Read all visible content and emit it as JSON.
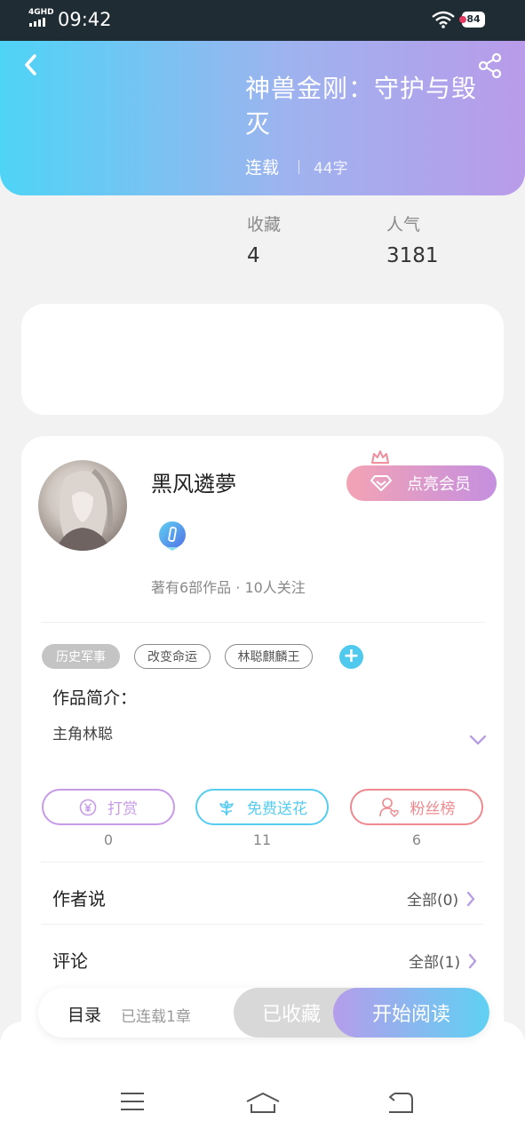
{
  "status_bar": {
    "network": "4GHD",
    "time": "09:42",
    "battery": "84"
  },
  "book": {
    "title": "神兽金刚：守护与毁灭",
    "status": "连载",
    "word_count": "44字"
  },
  "stats": [
    {
      "label": "收藏",
      "value": "4"
    },
    {
      "label": "人气",
      "value": "3181"
    }
  ],
  "author": {
    "name": "黑风遴夢",
    "info": "著有6部作品 · 10人关注",
    "vip_label": "点亮会员"
  },
  "tags": [
    "历史军事",
    "改变命运",
    "林聪麒麟王"
  ],
  "intro": {
    "title": "作品简介：",
    "text": "主角林聪"
  },
  "actions": [
    {
      "label": "打赏",
      "count": "0",
      "color": "#c79be8"
    },
    {
      "label": "免费送花",
      "count": "11",
      "color": "#56cdf0"
    },
    {
      "label": "粉丝榜",
      "count": "6",
      "color": "#ec8a8f"
    }
  ],
  "sections": [
    {
      "title": "作者说",
      "link": "全部(0)"
    },
    {
      "title": "评论",
      "link": "全部(1)"
    }
  ],
  "bottom_bar": {
    "toc_label": "目录",
    "toc_status": "已连载1章",
    "collected_label": "已收藏",
    "read_label": "开始阅读"
  }
}
